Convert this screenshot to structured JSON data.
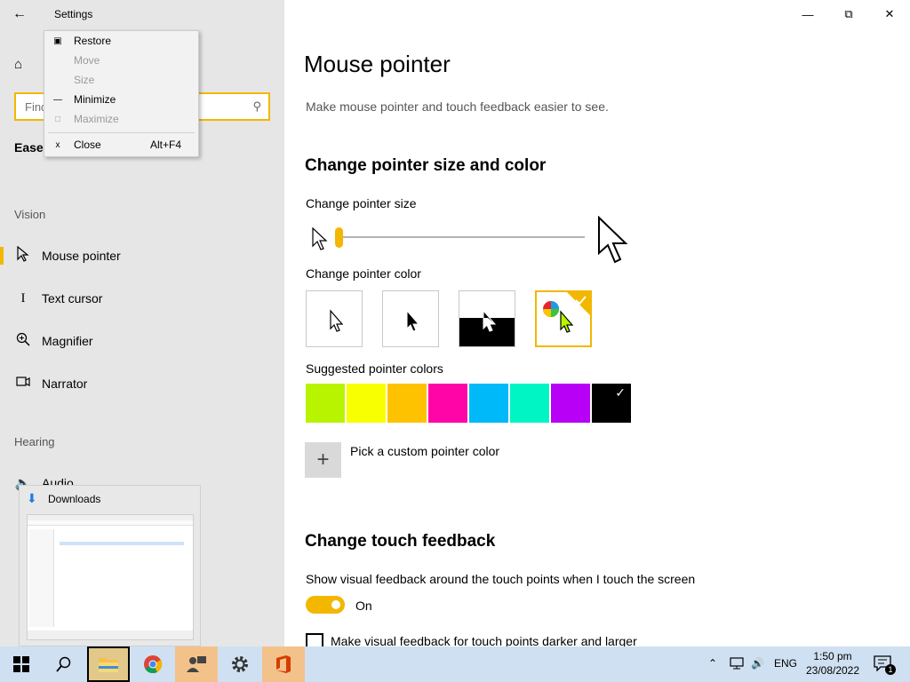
{
  "window": {
    "title": "Settings",
    "back_icon": "back-arrow-icon",
    "home_icon": "home-icon",
    "controls": {
      "minimize": "—",
      "restore": "⧉",
      "close": "✕"
    }
  },
  "context_menu": {
    "items": [
      {
        "label": "Restore",
        "icon": "▣",
        "enabled": true
      },
      {
        "label": "Move",
        "icon": "",
        "enabled": false
      },
      {
        "label": "Size",
        "icon": "",
        "enabled": false
      },
      {
        "label": "Minimize",
        "icon": "—",
        "enabled": true
      },
      {
        "label": "Maximize",
        "icon": "□",
        "enabled": false
      },
      {
        "label": "Close",
        "icon": "x",
        "shortcut": "Alt+F4",
        "enabled": true
      }
    ]
  },
  "sidebar": {
    "search_placeholder": "Find a setting",
    "search_value": "",
    "section_title": "Ease",
    "vision_label": "Vision",
    "hearing_label": "Hearing",
    "items": [
      {
        "label": "Mouse pointer",
        "icon": "♖",
        "selected": true
      },
      {
        "label": "Text cursor",
        "icon": "I",
        "selected": false
      },
      {
        "label": "Magnifier",
        "icon": "⌕",
        "selected": false
      },
      {
        "label": "Narrator",
        "icon": "▢",
        "selected": false
      },
      {
        "label": "Audio",
        "icon": "🔈",
        "selected": false
      }
    ]
  },
  "main": {
    "title": "Mouse pointer",
    "description": "Make mouse pointer and touch feedback easier to see.",
    "size_color_heading": "Change pointer size and color",
    "pointer_size_label": "Change pointer size",
    "pointer_size_value": 1,
    "pointer_color_label": "Change pointer color",
    "pointer_color_options": [
      "white",
      "black",
      "inverted",
      "custom"
    ],
    "pointer_color_selected": "custom",
    "suggested_label": "Suggested pointer colors",
    "suggested_colors": [
      "#b8f400",
      "#f8ff00",
      "#ffc200",
      "#ff05a8",
      "#00b9f9",
      "#00f5c4",
      "#b700f5",
      "#000000"
    ],
    "suggested_selected_index": 7,
    "custom_color_label": "Pick a custom pointer color",
    "touch_heading": "Change touch feedback",
    "touch_desc": "Show visual feedback around the touch points when I touch the screen",
    "touch_toggle_state": "On",
    "touch_checkbox_label": "Make visual feedback for touch points darker and larger"
  },
  "taskbar_preview": {
    "title": "Downloads"
  },
  "taskbar": {
    "buttons": [
      "start-icon",
      "search-icon",
      "file-explorer-icon",
      "chrome-icon",
      "people-icon",
      "settings-icon",
      "office-icon"
    ],
    "language": "ENG",
    "time": "1:50 pm",
    "date": "23/08/2022",
    "notification_count": "1",
    "accent_color": "#f3b700"
  }
}
